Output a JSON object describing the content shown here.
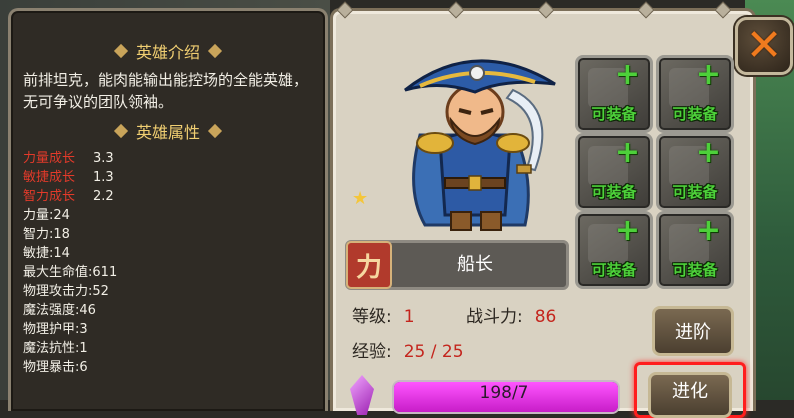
{
  "hero_intro": {
    "title": "英雄介绍",
    "text": "前排坦克，能肉能输出能控场的全能英雄，无可争议的团队领袖。"
  },
  "hero_attributes": {
    "title": "英雄属性",
    "growth": [
      {
        "label": "力量成长",
        "value": "3.3"
      },
      {
        "label": "敏捷成长",
        "value": "1.3"
      },
      {
        "label": "智力成长",
        "value": "2.2"
      }
    ],
    "stats": [
      {
        "label": "力量",
        "value": "24"
      },
      {
        "label": "智力",
        "value": "18"
      },
      {
        "label": "敏捷",
        "value": "14"
      },
      {
        "label": "最大生命值",
        "value": "611"
      },
      {
        "label": "物理攻击力",
        "value": "52"
      },
      {
        "label": "魔法强度",
        "value": "46"
      },
      {
        "label": "物理护甲",
        "value": "3"
      },
      {
        "label": "魔法抗性",
        "value": "1"
      },
      {
        "label": "物理暴击",
        "value": "6"
      }
    ]
  },
  "hero": {
    "name_icon_text": "力",
    "name": "船长",
    "stars": 1,
    "level_label": "等级",
    "level_value": "1",
    "power_label": "战斗力",
    "power_value": "86",
    "exp_label": "经验",
    "exp_value": "25 / 25"
  },
  "equipment_slots": [
    {
      "label": "可装备"
    },
    {
      "label": "可装备"
    },
    {
      "label": "可装备"
    },
    {
      "label": "可装备"
    },
    {
      "label": "可装备"
    },
    {
      "label": "可装备"
    }
  ],
  "buttons": {
    "advance": "进阶",
    "evolve": "进化"
  },
  "soul_progress": {
    "text": "198/7",
    "fill_fraction": 1.0
  },
  "colors": {
    "accent_gold": "#f1cf72",
    "equip_green": "#4dd03a",
    "stat_red": "#c4251d",
    "progress_magenta": "#e040e8"
  }
}
